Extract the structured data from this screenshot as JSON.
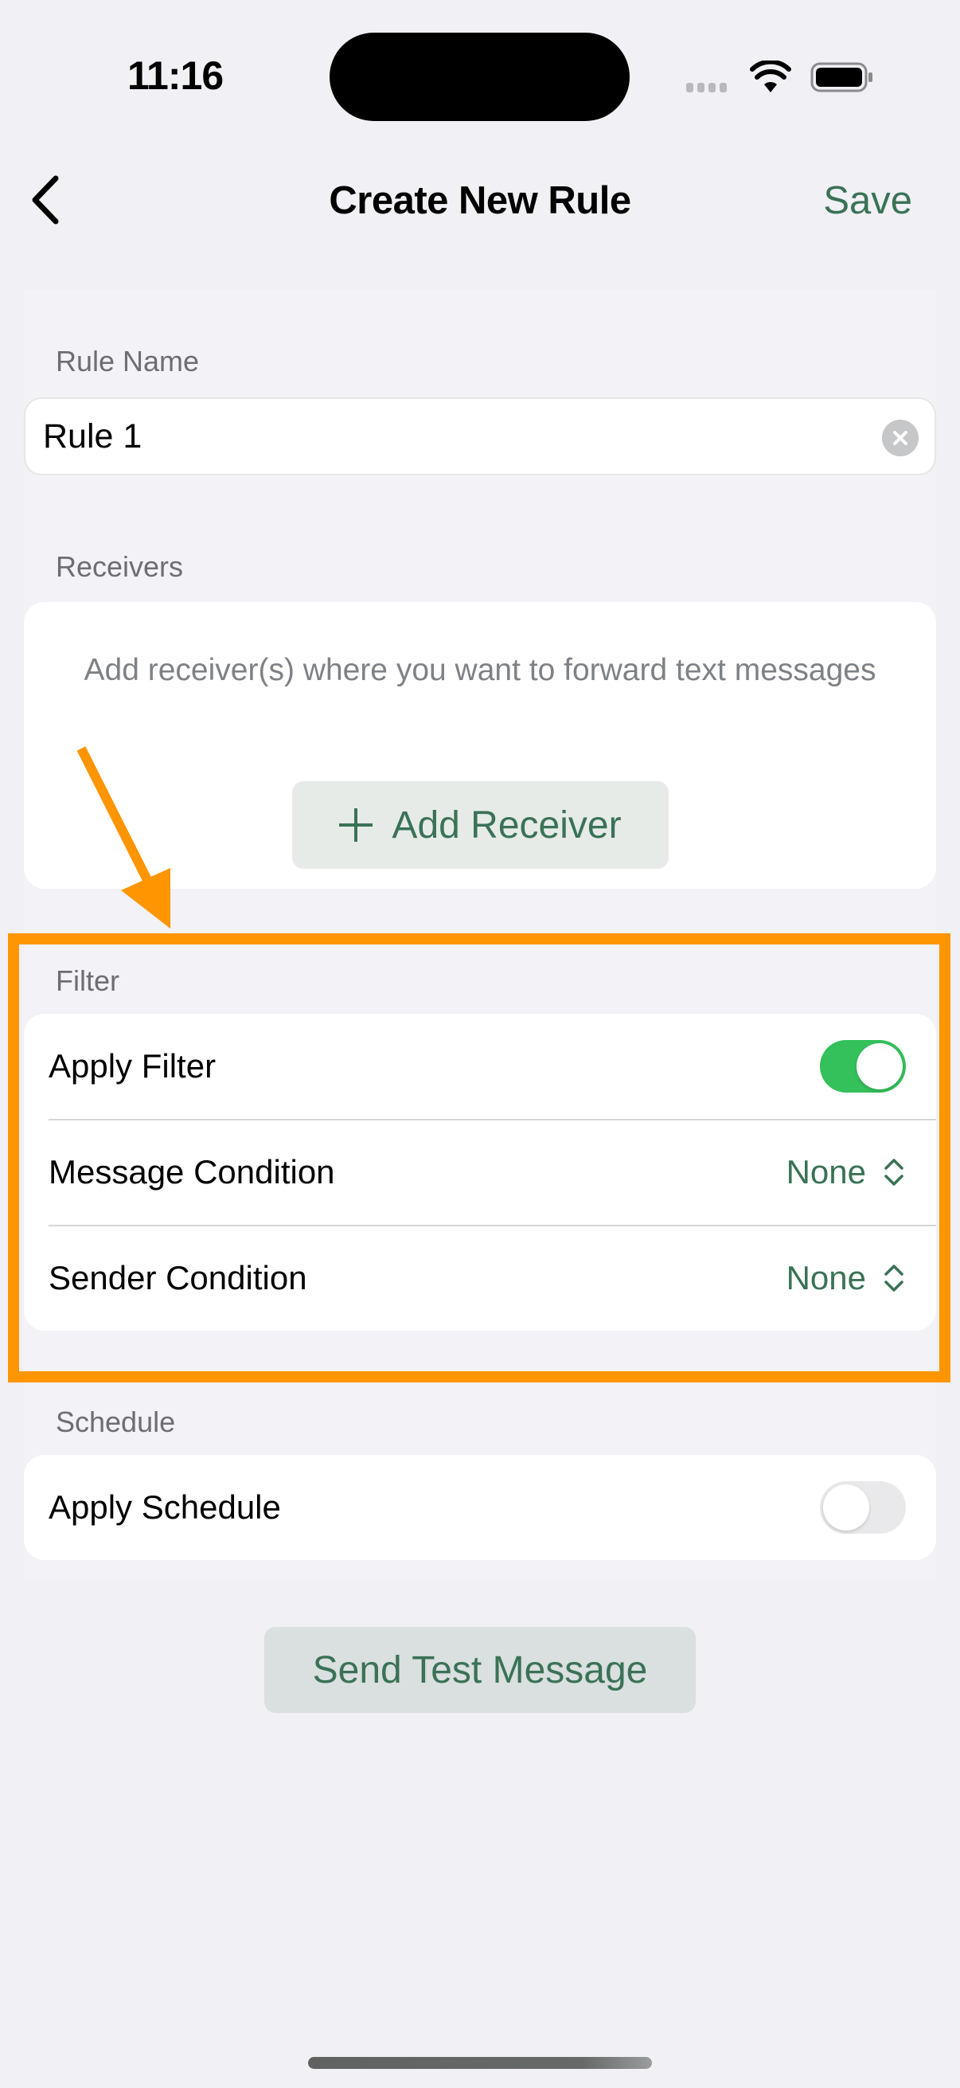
{
  "status_bar": {
    "time": "11:16",
    "icons": [
      "signal-icon",
      "wifi-icon",
      "battery-icon"
    ]
  },
  "nav": {
    "back_icon": "chevron-left-icon",
    "title": "Create New Rule",
    "save_label": "Save"
  },
  "rule_name": {
    "label": "Rule Name",
    "value": "Rule 1",
    "clear_icon": "clear-circle-icon"
  },
  "receivers": {
    "label": "Receivers",
    "hint": "Add receiver(s) where you want to forward text messages",
    "add_button_label": "Add Receiver",
    "add_icon": "plus-icon"
  },
  "filter": {
    "label": "Filter",
    "apply_filter_label": "Apply Filter",
    "apply_filter_on": true,
    "message_condition_label": "Message Condition",
    "message_condition_value": "None",
    "sender_condition_label": "Sender Condition",
    "sender_condition_value": "None"
  },
  "schedule": {
    "label": "Schedule",
    "apply_schedule_label": "Apply Schedule",
    "apply_schedule_on": false
  },
  "send_test_label": "Send Test Message",
  "colors": {
    "accent": "#3a7256",
    "toggle_on": "#34c05a",
    "annotation": "#ff9500",
    "background": "#f0f0f5"
  }
}
